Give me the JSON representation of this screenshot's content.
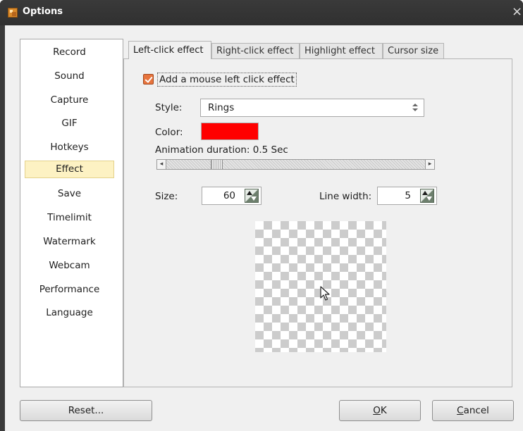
{
  "window": {
    "title": "Options",
    "close_glyph": "×"
  },
  "sidebar": {
    "items": [
      {
        "label": "Record"
      },
      {
        "label": "Sound"
      },
      {
        "label": "Capture"
      },
      {
        "label": "GIF"
      },
      {
        "label": "Hotkeys"
      },
      {
        "label": "Effect",
        "selected": true
      },
      {
        "label": "Save"
      },
      {
        "label": "Timelimit"
      },
      {
        "label": "Watermark"
      },
      {
        "label": "Webcam"
      },
      {
        "label": "Performance"
      },
      {
        "label": "Language"
      }
    ]
  },
  "tabs": [
    {
      "label": "Left-click effect",
      "active": true
    },
    {
      "label": "Right-click effect"
    },
    {
      "label": "Highlight effect"
    },
    {
      "label": "Cursor size"
    }
  ],
  "left_click": {
    "add_effect_label": "Add a mouse left click effect",
    "add_effect_checked": true,
    "style_label": "Style:",
    "style_value": "Rings",
    "color_label": "Color:",
    "color_value": "#ff0000",
    "animation_label": "Animation duration: 0.5 Sec",
    "animation_slider_position": 0.18,
    "size_label": "Size:",
    "size_value": "60",
    "line_width_label": "Line width:",
    "line_width_value": "5"
  },
  "buttons": {
    "reset": "Reset...",
    "ok_accel": "O",
    "ok_rest": "K",
    "cancel_accel": "C",
    "cancel_rest": "ancel"
  },
  "colors": {
    "titlebar": "#333333",
    "selected_item_bg": "#fdf2c3",
    "checkbox_accent": "#e7743d"
  },
  "icons": {
    "app": "app-icon",
    "close": "close-icon",
    "spin": "spin-arrows-icon",
    "cursor": "mouse-cursor-icon"
  }
}
